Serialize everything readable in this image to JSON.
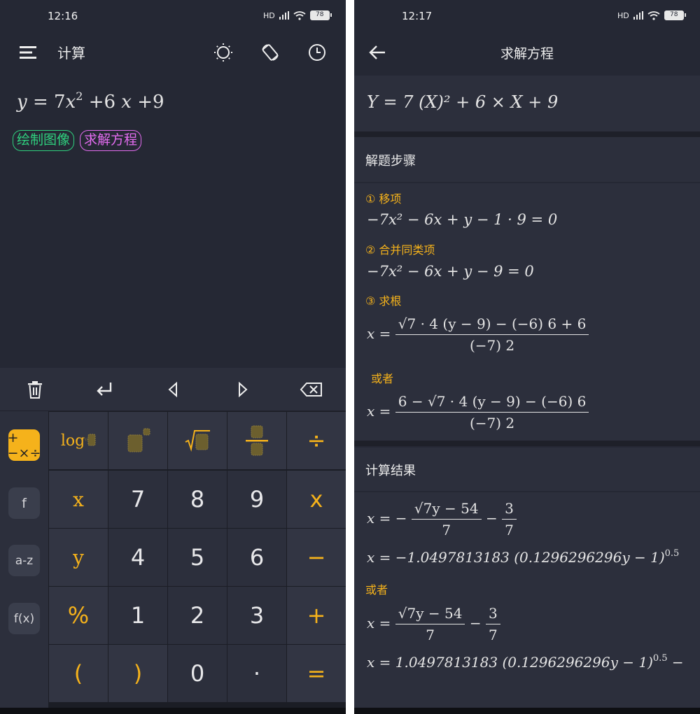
{
  "left": {
    "status": {
      "time": "12:16",
      "network": "HD",
      "battery": "78"
    },
    "toolbar": {
      "title": "计算"
    },
    "expression": {
      "y": "y",
      "eq": "=",
      "coef": "7",
      "x": "x",
      "exp": "2",
      "term2": "+6",
      "x2": "x",
      "term3": "+9"
    },
    "chips": {
      "plot": "绘制图像",
      "solve": "求解方程"
    },
    "side_buttons": {
      "ops": "+−×÷",
      "f": "f",
      "az": "a-z",
      "fx": "f(x)"
    },
    "keys": {
      "r1": [
        "log",
        "",
        "√",
        "",
        "÷"
      ],
      "r2": [
        "x",
        "7",
        "8",
        "9",
        "x"
      ],
      "r3": [
        "y",
        "4",
        "5",
        "6",
        "−"
      ],
      "r4": [
        "%",
        "1",
        "2",
        "3",
        "+"
      ],
      "r5": [
        "(",
        ")",
        "0",
        "·",
        "="
      ]
    },
    "colors": {
      "accent": "#f5b21b",
      "green": "#2fd07e",
      "purple": "#e36cf0",
      "bg": "#252834"
    }
  },
  "right": {
    "status": {
      "time": "12:17",
      "network": "HD",
      "battery": "78"
    },
    "toolbar": {
      "title": "求解方程"
    },
    "equation": "Y = 7 (X)² + 6 × X + 9",
    "steps_title": "解题步骤",
    "steps": [
      {
        "label": "① 移项",
        "formula": "−7x² − 6x + y − 1 · 9 = 0"
      },
      {
        "label": "② 合并同类项",
        "formula": "−7x² − 6x + y − 9 = 0"
      },
      {
        "label": "③ 求根",
        "formula_num": "√7 · 4 (y − 9) − (−6) 6 + 6",
        "formula_den": "(−7) 2"
      }
    ],
    "or_label": "或者",
    "step3_alt": {
      "num": "6 − √7 · 4 (y − 9) − (−6) 6",
      "den": "(−7) 2"
    },
    "result_title": "计算结果",
    "results": {
      "r1": {
        "prefix": "x = −",
        "num": "√7y − 54",
        "den": "7",
        "minus": "−",
        "num2": "3",
        "den2": "7"
      },
      "r2": "x = −1.0497813183 (0.1296296296y − 1)",
      "r2_exp": "0.5",
      "r3": {
        "prefix": "x =",
        "num": "√7y − 54",
        "den": "7",
        "minus": "−",
        "num2": "3",
        "den2": "7"
      },
      "r4": "x = 1.0497813183 (0.1296296296y − 1)",
      "r4_exp": "0.5",
      "r4_tail": "−"
    }
  }
}
